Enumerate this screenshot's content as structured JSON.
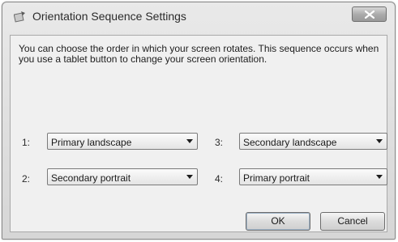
{
  "dialog": {
    "title": "Orientation Sequence Settings",
    "description": "You can choose the order in which your screen rotates. This sequence occurs when you use a tablet button to change your screen orientation."
  },
  "selects": [
    {
      "label": "1:",
      "value": "Primary landscape"
    },
    {
      "label": "2:",
      "value": "Secondary portrait"
    },
    {
      "label": "3:",
      "value": "Secondary landscape"
    },
    {
      "label": "4:",
      "value": "Primary portrait"
    }
  ],
  "buttons": {
    "ok": "OK",
    "cancel": "Cancel"
  },
  "icons": {
    "title": "tablet-orientation-icon",
    "close": "close-icon",
    "dropdown": "chevron-down-icon"
  }
}
